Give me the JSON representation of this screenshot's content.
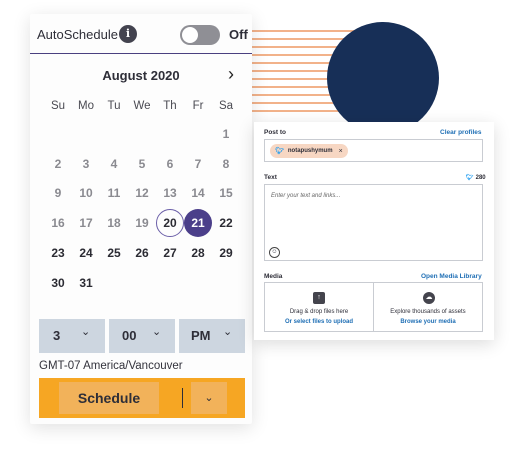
{
  "colors": {
    "accent_purple": "#4b3f8a",
    "schedule_orange": "#f6a623",
    "link_blue": "#1f6fb5",
    "twitter_blue": "#1d9bf0",
    "decor_navy": "#172f57",
    "decor_stripes": "#f2b28a"
  },
  "scheduler": {
    "autoschedule_label": "AutoSchedule",
    "info_icon": "i",
    "toggle_state": "Off",
    "month_title": "August 2020",
    "next_icon": "›",
    "weekdays": [
      "Su",
      "Mo",
      "Tu",
      "We",
      "Th",
      "Fr",
      "Sa"
    ],
    "weeks": [
      [
        "",
        "",
        "",
        "",
        "",
        "",
        "1"
      ],
      [
        "2",
        "3",
        "4",
        "5",
        "6",
        "7",
        "8"
      ],
      [
        "9",
        "10",
        "11",
        "12",
        "13",
        "14",
        "15"
      ],
      [
        "16",
        "17",
        "18",
        "19",
        "20",
        "21",
        "22"
      ],
      [
        "23",
        "24",
        "25",
        "26",
        "27",
        "28",
        "29"
      ],
      [
        "30",
        "31",
        "",
        "",
        "",
        "",
        ""
      ]
    ],
    "today": "20",
    "selected": "21",
    "hour": "3",
    "minute": "00",
    "ampm": "PM",
    "chevron": "⌄",
    "timezone": "GMT-07 America/Vancouver",
    "schedule_button": "Schedule",
    "more_icon": "⌄"
  },
  "composer": {
    "post_to_label": "Post to",
    "clear_profiles": "Clear profiles",
    "profile_chip": "notapushymum",
    "chip_remove": "×",
    "text_label": "Text",
    "char_count": "280",
    "text_placeholder": "Enter your text and links...",
    "media_label": "Media",
    "open_media_library": "Open Media Library",
    "upload_text": "Drag & drop files here",
    "upload_link": "Or select files to upload",
    "browse_text": "Explore thousands of assets",
    "browse_link": "Browse your media"
  }
}
